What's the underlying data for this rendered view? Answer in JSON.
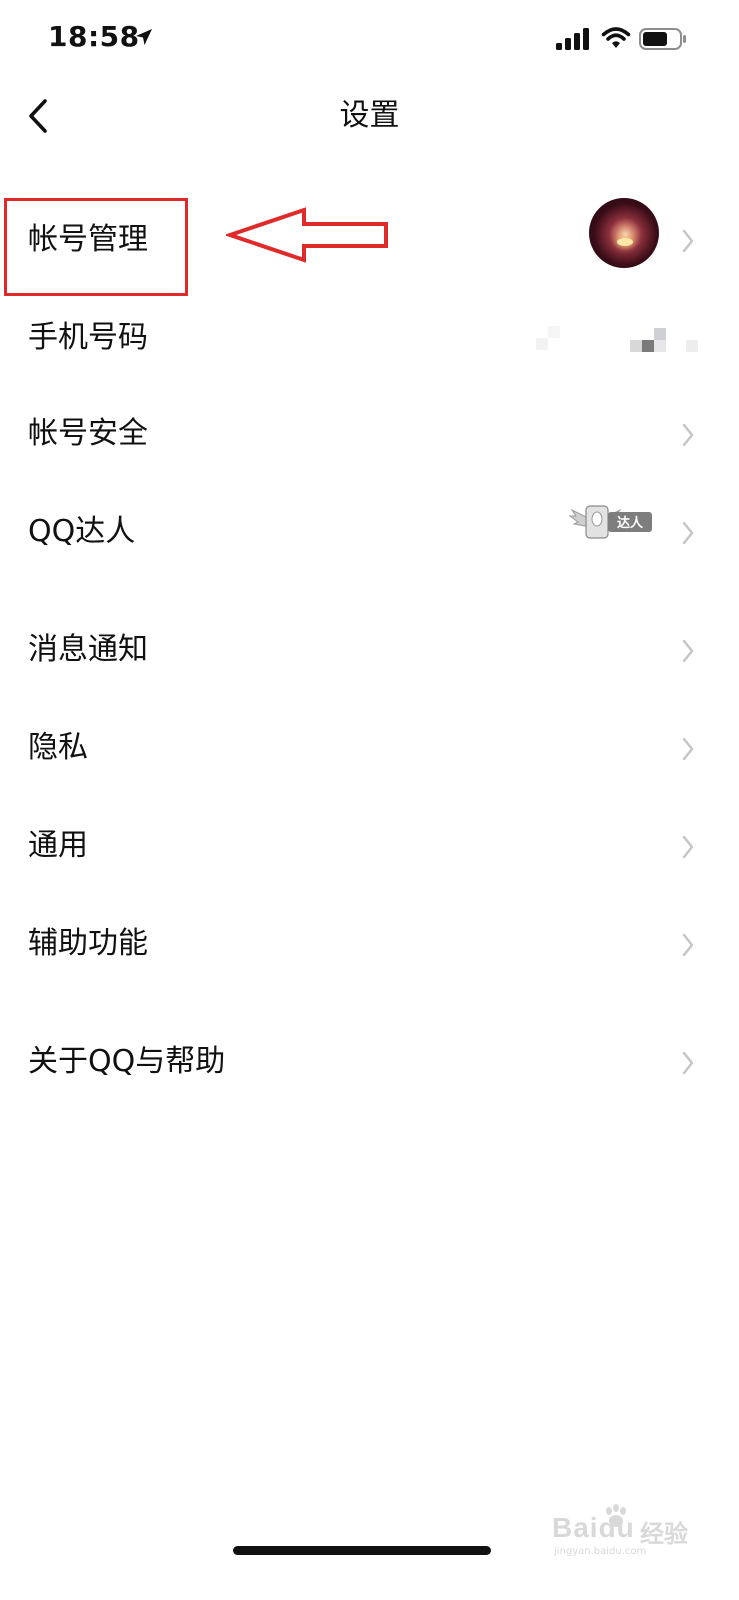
{
  "status_bar": {
    "time": "18:58"
  },
  "nav": {
    "title": "设置"
  },
  "menu": {
    "account_management": "帐号管理",
    "phone_number": "手机号码",
    "account_security": "帐号安全",
    "qq_master": "QQ达人",
    "qq_master_badge": "达人",
    "notifications": "消息通知",
    "privacy": "隐私",
    "general": "通用",
    "accessibility": "辅助功能",
    "about": "关于QQ与帮助"
  },
  "watermark": {
    "brand": "Baidu",
    "brand_cn": "经验",
    "site": "jingyan.baidu.com"
  },
  "colors": {
    "annotation_red": "#e02a2a",
    "text": "#111111",
    "chevron": "#c4c4c4",
    "background": "#ffffff"
  }
}
